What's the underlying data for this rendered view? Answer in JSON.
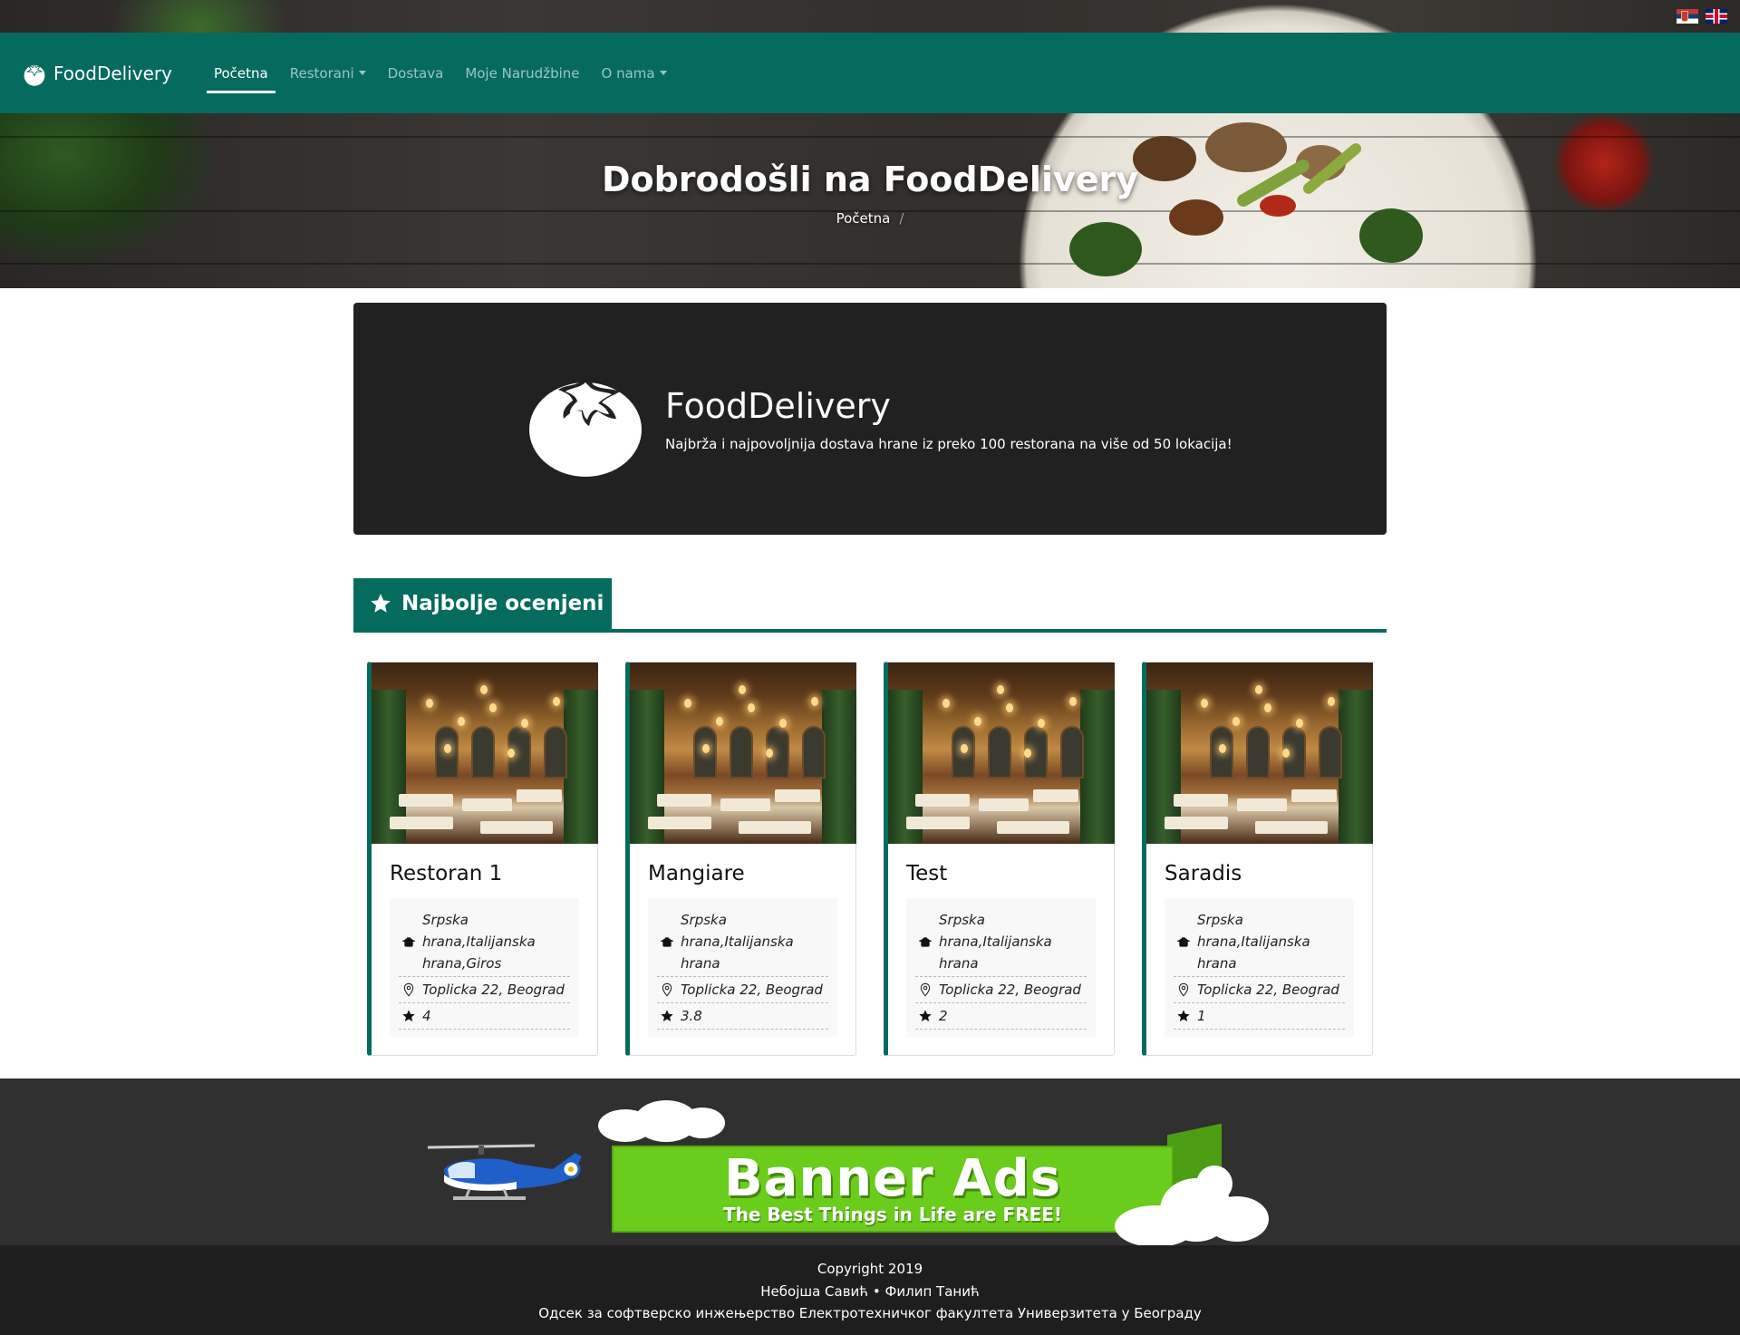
{
  "languages": [
    {
      "code": "sr",
      "label": "Srpski"
    },
    {
      "code": "en",
      "label": "English"
    }
  ],
  "navbar": {
    "brand": "FoodDelivery",
    "items": [
      {
        "label": "Početna",
        "active": true,
        "dropdown": false
      },
      {
        "label": "Restorani",
        "active": false,
        "dropdown": true
      },
      {
        "label": "Dostava",
        "active": false,
        "dropdown": false
      },
      {
        "label": "Moje Narudžbine",
        "active": false,
        "dropdown": false
      },
      {
        "label": "O nama",
        "active": false,
        "dropdown": true
      }
    ]
  },
  "hero": {
    "title": "Dobrodošli na FoodDelivery",
    "breadcrumb": "Početna",
    "breadcrumb_separator": "/"
  },
  "jumbotron": {
    "title": "FoodDelivery",
    "text": "Najbrža i najpovoljnija dostava hrane iz preko 100 restorana na više od 50 lokacija!"
  },
  "section": {
    "title": "Najbolje ocenjeni"
  },
  "restaurants": [
    {
      "name": "Restoran 1",
      "categories": "Srpska hrana,Italijanska hrana,Giros",
      "address": "Toplicka 22, Beograd",
      "rating": "4"
    },
    {
      "name": "Mangiare",
      "categories": "Srpska hrana,Italijanska hrana",
      "address": "Toplicka 22, Beograd",
      "rating": "3.8"
    },
    {
      "name": "Test",
      "categories": "Srpska hrana,Italijanska hrana",
      "address": "Toplicka 22, Beograd",
      "rating": "2"
    },
    {
      "name": "Saradis",
      "categories": "Srpska hrana,Italijanska hrana",
      "address": "Toplicka 22, Beograd",
      "rating": "1"
    }
  ],
  "banner": {
    "headline": "Banner Ads",
    "tagline": "The Best Things in Life are FREE!"
  },
  "footer": {
    "copyright": "Copyright 2019",
    "authors": "Небојша Савић • Филип Танић",
    "institution": "Одсек за софтверско инжењерство Електротехничког факултета Универзитета у Београду"
  },
  "colors": {
    "primary": "#056b5e",
    "jumbotron_bg": "#212121",
    "banner_band": "#303030",
    "footer_bg": "#1e1e1e",
    "banner_green": "#6acc1b"
  },
  "icons": {
    "brand": "tomato-icon",
    "section": "star-icon",
    "category": "cooking-pot-icon",
    "address": "map-marker-icon",
    "rating": "star-icon"
  }
}
